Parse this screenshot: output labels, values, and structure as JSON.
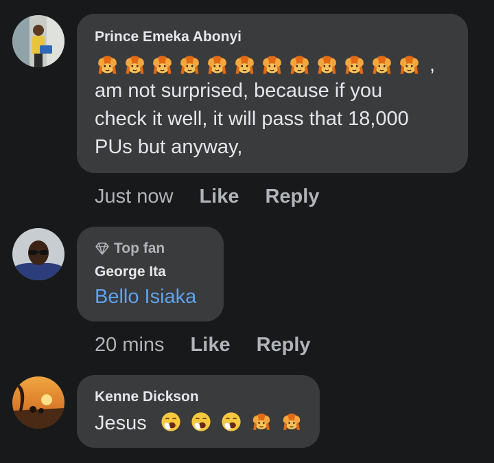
{
  "comments": [
    {
      "author": "Prince Emeka Abonyi",
      "emoji_sequence": [
        "facepalm-emoji",
        "facepalm-emoji",
        "facepalm-emoji",
        "facepalm-emoji",
        "facepalm-emoji",
        "facepalm-emoji",
        "facepalm-emoji",
        "facepalm-emoji",
        "facepalm-emoji",
        "facepalm-emoji",
        "facepalm-emoji",
        "facepalm-emoji"
      ],
      "emoji_trailing": ",",
      "text_lines": [
        "am not surprised, because if you",
        "check it well, it will pass that 18,000",
        "PUs but anyway,"
      ],
      "time": "Just now",
      "like": "Like",
      "reply": "Reply"
    },
    {
      "badge": "Top fan",
      "author": "George Ita",
      "mention": "Bello Isiaka",
      "time": "20 mins",
      "like": "Like",
      "reply": "Reply"
    },
    {
      "author": "Kenne Dickson",
      "text": "Jesus",
      "emoji_sequence": [
        "yawning-face-emoji",
        "yawning-face-emoji",
        "yawning-face-emoji",
        "facepalm-emoji",
        "facepalm-emoji"
      ]
    }
  ],
  "colors": {
    "background": "#18191a",
    "bubble": "#3a3b3c",
    "text": "#e4e6eb",
    "secondary": "#b0b3b8",
    "mention": "#5ea3ef"
  }
}
